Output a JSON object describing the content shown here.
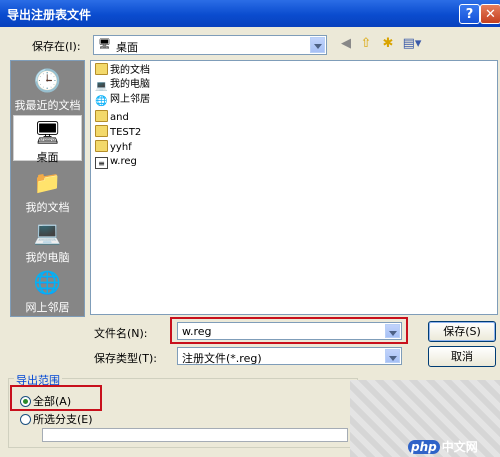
{
  "dialog": {
    "title": "导出注册表文件",
    "help_glyph": "?",
    "close_glyph": "✕"
  },
  "toolbar": {
    "save_in_label": "保存在(I):",
    "location": "桌面",
    "icons": [
      "back-icon",
      "up-folder-icon",
      "new-folder-icon",
      "view-menu-icon"
    ]
  },
  "places": [
    {
      "label": "我最近的文档",
      "icon": "recent-documents-icon",
      "glyph": "🕒"
    },
    {
      "label": "桌面",
      "icon": "desktop-icon",
      "glyph": "🖥"
    },
    {
      "label": "我的文档",
      "icon": "my-documents-icon",
      "glyph": "📁"
    },
    {
      "label": "我的电脑",
      "icon": "my-computer-icon",
      "glyph": "💻"
    },
    {
      "label": "网上邻居",
      "icon": "network-places-icon",
      "glyph": "🌐"
    }
  ],
  "files": [
    {
      "name": "我的文档",
      "icon": "folder-icon"
    },
    {
      "name": "我的电脑",
      "icon": "computer-icon"
    },
    {
      "name": "网上邻居",
      "icon": "network-icon"
    },
    {
      "name": "and",
      "icon": "folder-icon"
    },
    {
      "name": "TEST2",
      "icon": "folder-icon"
    },
    {
      "name": "yyhf",
      "icon": "folder-icon"
    },
    {
      "name": "w.reg",
      "icon": "registry-file-icon"
    }
  ],
  "form": {
    "filename_label": "文件名(N):",
    "filename_value": "w.reg",
    "filetype_label": "保存类型(T):",
    "filetype_value": "注册文件(*.reg)",
    "save_button": "保存(S)",
    "cancel_button": "取消"
  },
  "export_range": {
    "title": "导出范围",
    "all_label": "全部(A)",
    "branch_label": "所选分支(E)",
    "selected": "all",
    "branch_value": ""
  },
  "watermark": {
    "logo": "php",
    "text": "中文网"
  },
  "colors": {
    "titlebar": "#0a4ccf",
    "highlight": "#c8101c",
    "places_bg": "#868686"
  }
}
